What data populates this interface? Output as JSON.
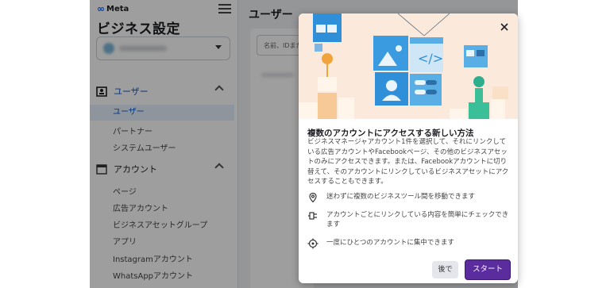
{
  "sidebar": {
    "logo_text": "Meta",
    "title": "ビジネス設定",
    "sections": [
      {
        "label": "ユーザー",
        "items": [
          "ユーザー",
          "パートナー",
          "システムユーザー"
        ]
      },
      {
        "label": "アカウント",
        "items": [
          "ページ",
          "広告アカウント",
          "ビジネスアセットグループ",
          "アプリ",
          "Instagramアカウント",
          "WhatsAppアカウント"
        ]
      }
    ]
  },
  "content": {
    "title": "ユーザー",
    "search_placeholder": "名前、IDまたはメールアドレスで検索"
  },
  "modal": {
    "title": "複数のアカウントにアクセスする新しい方法",
    "description": "ビジネスマネージャアカウント1件を選択して、それにリンクしている広告アカウントやFacebookページ、その他のビジネスアセットのみにアクセスできます。または、Facebookアカウントに切り替えて、そのアカウントにリンクしているビジネスアセットにアクセスすることもできます。",
    "features": [
      {
        "icon": "location-pin-icon",
        "text": "迷わずに複数のビジネスツール間を移動できます"
      },
      {
        "icon": "plug-icon",
        "text": "アカウントごとにリンクしている内容を簡単にチェックできます"
      },
      {
        "icon": "crosshair-icon",
        "text": "一度にひとつのアカウントに集中できます"
      }
    ],
    "later_label": "後で",
    "start_label": "スタート"
  },
  "colors": {
    "accent": "#5b2c9e",
    "link": "#0a55c9",
    "hero_bg": "#fbe9dc"
  }
}
